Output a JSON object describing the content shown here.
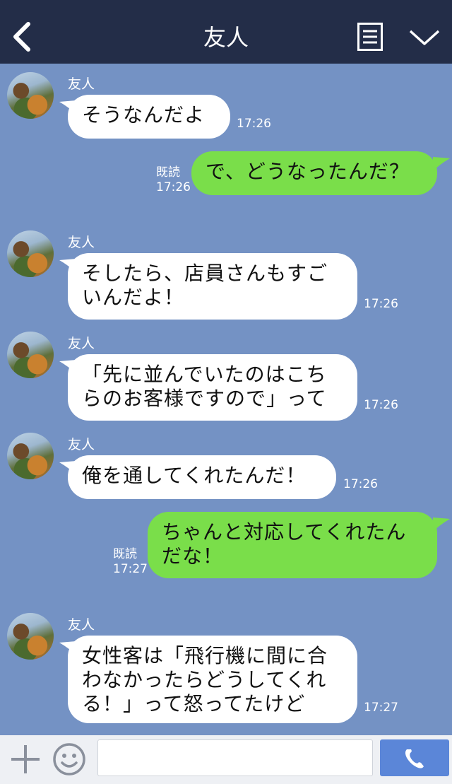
{
  "header": {
    "title": "友人"
  },
  "messages": [
    {
      "sender": "友人",
      "text": "そうなんだよ",
      "time": "17:26"
    },
    {
      "read": "既読",
      "time": "17:26",
      "text": "で、どうなったんだ？"
    },
    {
      "sender": "友人",
      "line1": "そしたら、店員さんもすご",
      "line2": "いんだよ！",
      "time": "17:26"
    },
    {
      "sender": "友人",
      "line1": "「先に並んでいたのはこち",
      "line2": "らのお客様ですので」って",
      "time": "17:26"
    },
    {
      "sender": "友人",
      "text": "俺を通してくれたんだ！",
      "time": "17:26"
    },
    {
      "read": "既読",
      "time": "17:27",
      "line1": "ちゃんと対応してくれたん",
      "line2": "だな！"
    },
    {
      "sender": "友人",
      "line1": "女性客は「飛行機に間に合",
      "line2": "わなかったらどうしてくれ",
      "line3": "る！」って怒ってたけど",
      "time": "17:27"
    }
  ],
  "colors": {
    "header_bg": "#232d48",
    "chat_bg": "#7492c4",
    "green_bubble": "#7ade4a",
    "call_button": "#5b86d8"
  }
}
